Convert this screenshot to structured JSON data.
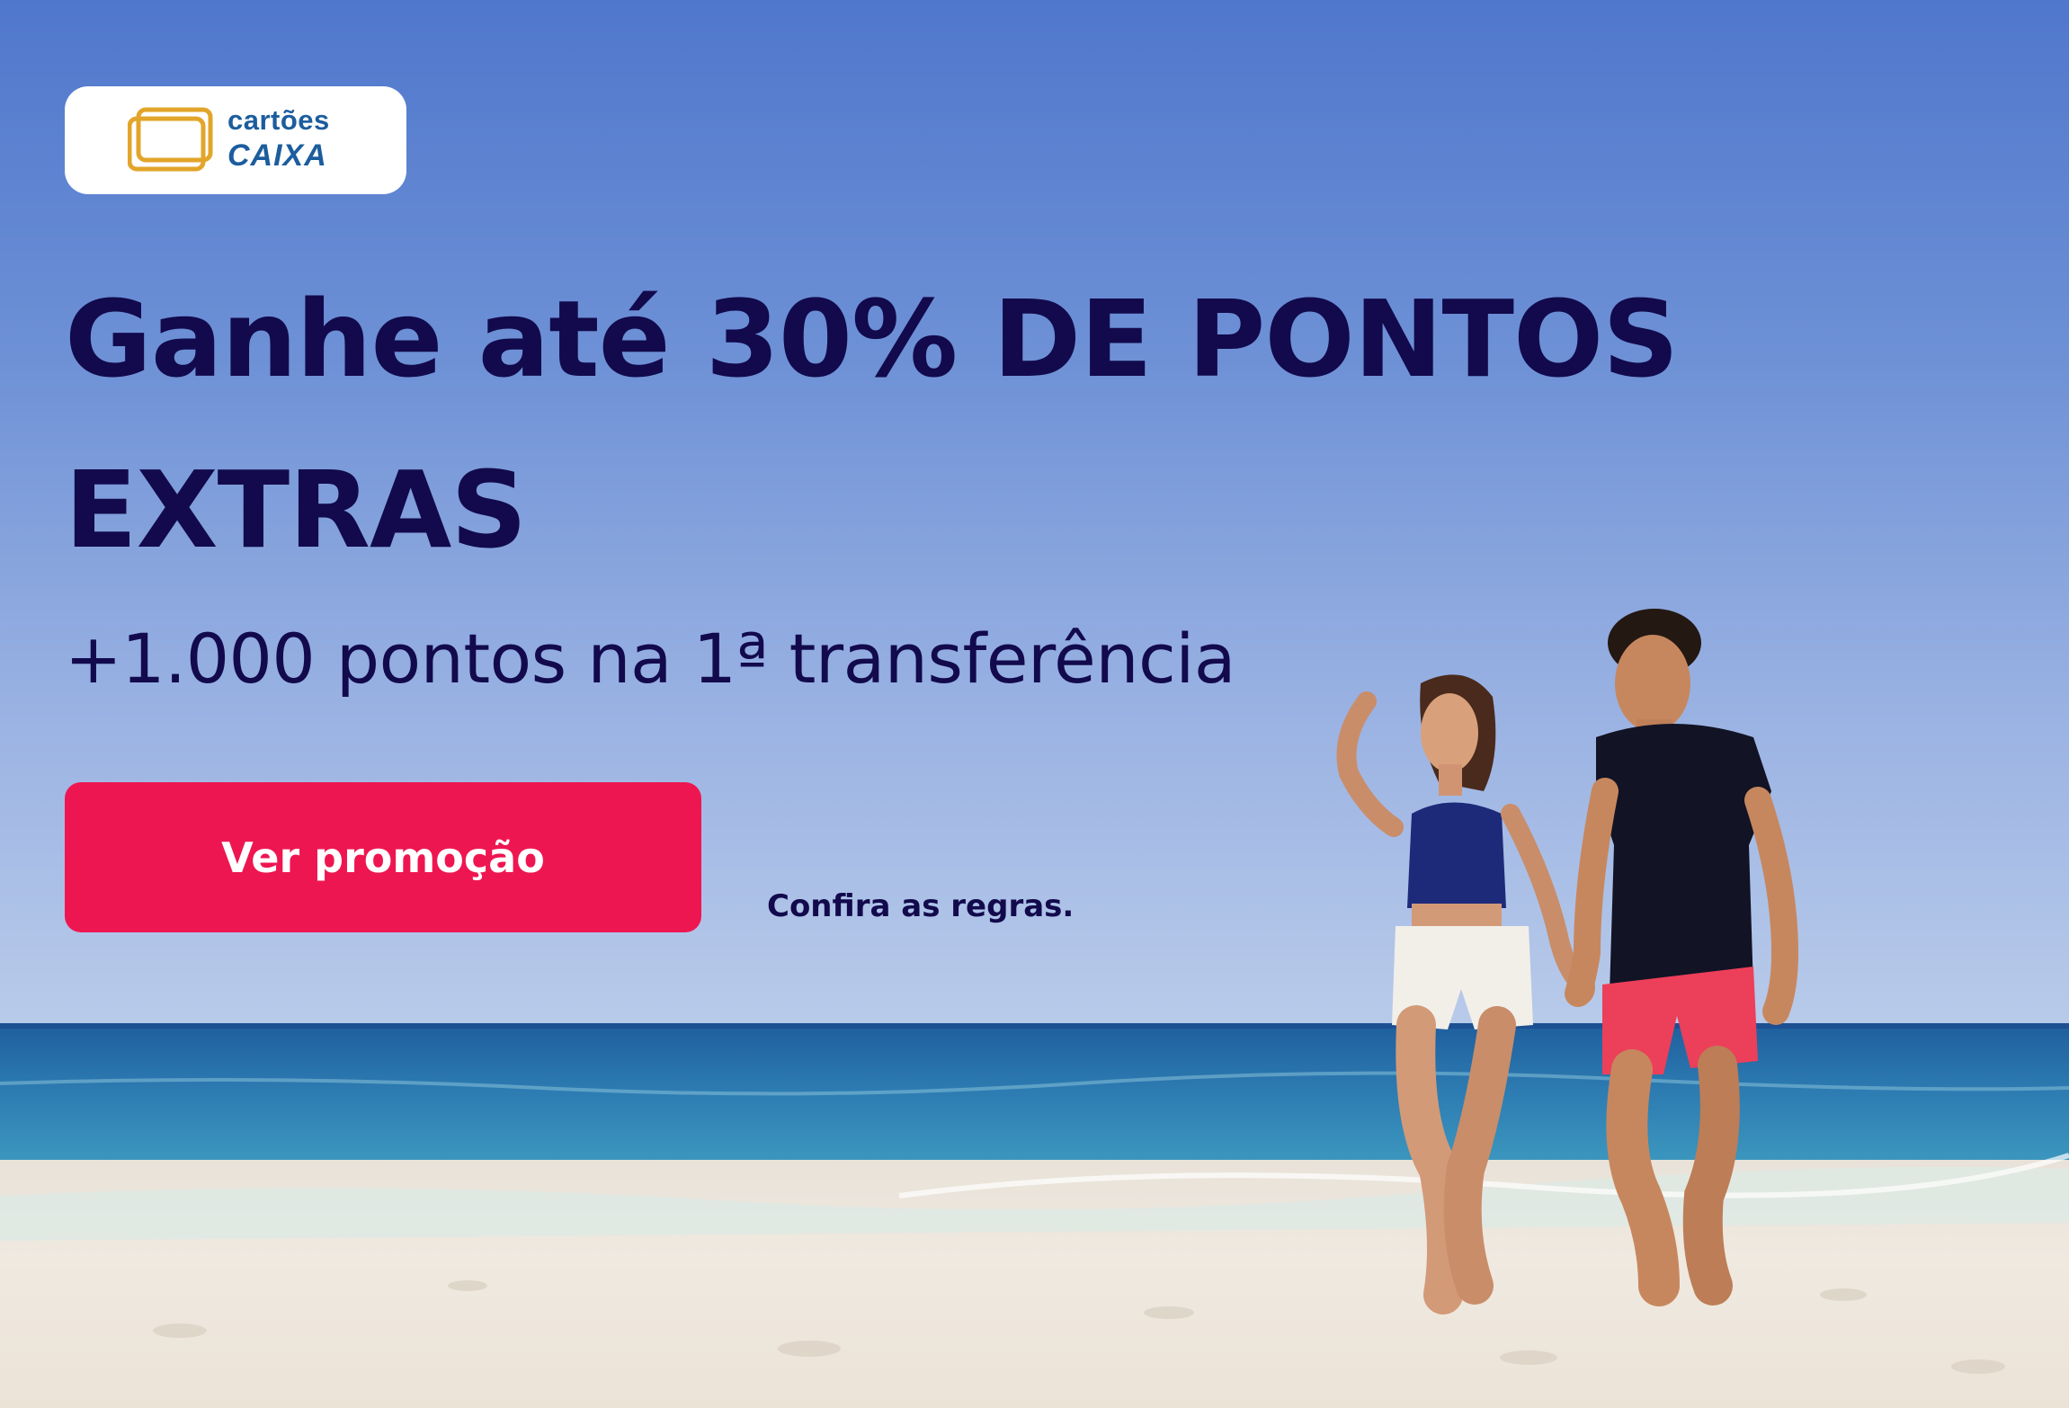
{
  "brand": {
    "line1": "cartões",
    "line2": "CAIXA",
    "icon": "card-stack-icon",
    "colors": {
      "blue": "#1c5d9d",
      "gold": "#e2a52a"
    }
  },
  "hero": {
    "headline": "Ganhe até 30% DE PONTOS EXTRAS",
    "subheadline": "+1.000 pontos na 1ª transferência",
    "cta_label": "Ver promoção",
    "rules_link": "Confira as regras.",
    "background": "beach-couple-photo"
  },
  "colors": {
    "text": "#120a4c",
    "cta": "#ee1651",
    "cta_text": "#ffffff"
  }
}
